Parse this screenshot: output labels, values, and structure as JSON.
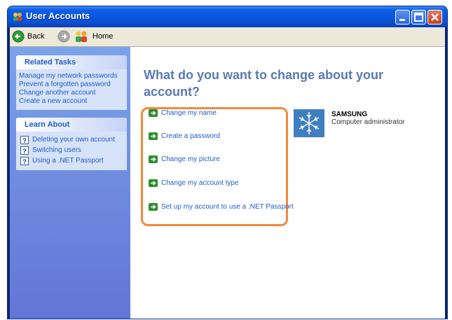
{
  "window": {
    "title": "User Accounts"
  },
  "toolbar": {
    "back_label": "Back",
    "home_label": "Home"
  },
  "sidebar": {
    "related_tasks": {
      "heading": "Related Tasks",
      "items": [
        "Manage my network passwords",
        "Prevent a forgotten password",
        "Change another account",
        "Create a new account"
      ]
    },
    "learn_about": {
      "heading": "Learn About",
      "items": [
        "Deleting your own account",
        "Switching users",
        "Using a .NET Passport"
      ]
    }
  },
  "main": {
    "title": "What do you want to change about your account?",
    "options": [
      "Change my name",
      "Create a password",
      "Change my picture",
      "Change my account type",
      "Set up my account to use a .NET Passport"
    ]
  },
  "user": {
    "name": "SAMSUNG",
    "role": "Computer administrator"
  },
  "colors": {
    "highlight": "#f08a3c",
    "link": "#215dc6",
    "title_bar": "#0a55dc"
  }
}
